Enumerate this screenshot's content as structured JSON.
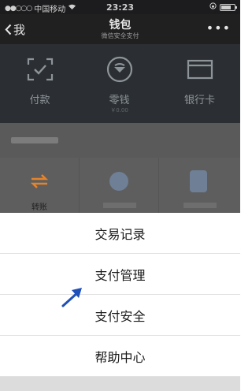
{
  "status_bar": {
    "carrier": "中国移动",
    "time": "23:23"
  },
  "nav": {
    "back_label": "我",
    "title": "钱包",
    "subtitle": "微信安全支付"
  },
  "wallet": {
    "items": [
      {
        "label": "付款",
        "icon": "scan-pay-icon"
      },
      {
        "label": "零钱",
        "sub": "￥0.00",
        "icon": "change-icon"
      },
      {
        "label": "银行卡",
        "icon": "bank-card-icon"
      }
    ]
  },
  "services": {
    "items": [
      {
        "label": "转账",
        "icon": "transfer-icon"
      }
    ]
  },
  "action_sheet": {
    "items": [
      "交易记录",
      "支付管理",
      "支付安全",
      "帮助中心"
    ]
  },
  "colors": {
    "accent_orange": "#e6832a",
    "annotation_blue": "#1f4fb8"
  }
}
